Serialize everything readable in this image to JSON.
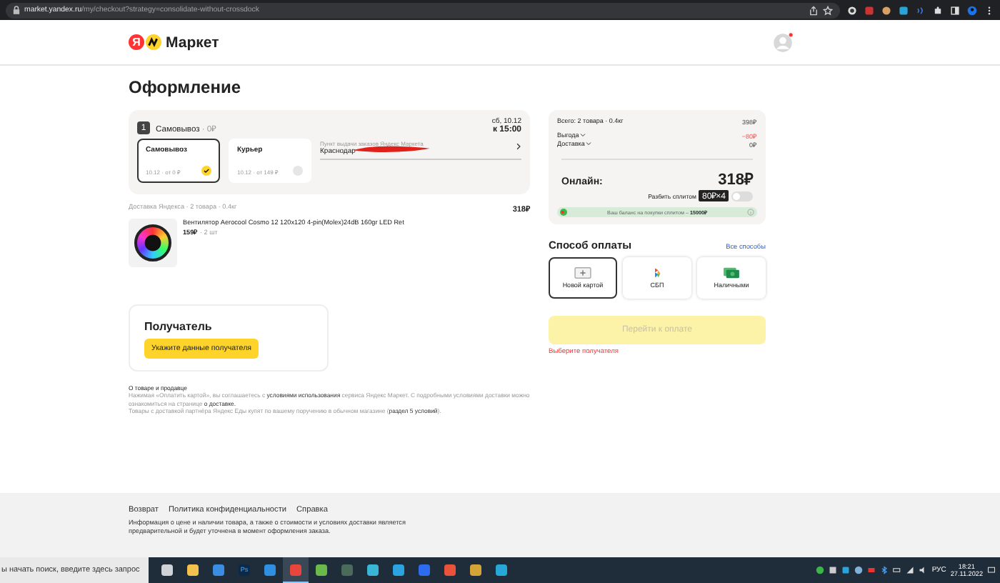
{
  "browser": {
    "url_domain": "market.yandex.ru",
    "url_path": "/my/checkout?strategy=consolidate-without-crossdock"
  },
  "header": {
    "logo_mark": "Я",
    "logo_text": "Маркет"
  },
  "page_title": "Оформление",
  "delivery": {
    "number": "1",
    "title": "Самовывоз",
    "price": " · 0₽",
    "date": "сб, 10.12",
    "time": "к 15:00",
    "options": [
      {
        "title": "Самовывоз",
        "detail": "10.12 · от 0 ₽",
        "selected": true
      },
      {
        "title": "Курьер",
        "detail": "10.12 · от 149 ₽",
        "selected": false
      }
    ],
    "pickup": {
      "label": "Пункт выдачи заказов Яндекс Маркета",
      "value": "Краснодар"
    },
    "shipment": {
      "label": "Доставка Яндекса · 2 товара · 0.4кг",
      "total": "318₽"
    },
    "products": [
      {
        "name": "Вентилятор Aerocool Cosmo 12 120x120 4-pin(Molex)24dB 160gr LED Ret",
        "price": "159₽",
        "qty": " · 2 шт"
      }
    ]
  },
  "recipient": {
    "title": "Получатель",
    "button": "Укажите данные получателя"
  },
  "legal": {
    "title": "О товаре и продавце",
    "paragraphs": [
      [
        {
          "text": "Нажимая «Оплатить картой», вы соглашаетесь с ",
          "link": false
        },
        {
          "text": "условиями использования",
          "link": true
        },
        {
          "text": " сервиса Яндекс Маркет. С подробными условиями доставки можно ознакомиться на странице ",
          "link": false
        },
        {
          "text": "о доставке.",
          "link": true
        }
      ],
      [
        {
          "text": "Товары с доставкой партнёра Яндекс Еды купят по вашему поручению в обычном магазине (",
          "link": false
        },
        {
          "text": "раздел 5 условий",
          "link": true
        },
        {
          "text": ").",
          "link": false
        }
      ]
    ]
  },
  "summary": {
    "rows": [
      {
        "label": "Всего: 2 товара · 0.4кг",
        "value": "398₽",
        "kind": "plain",
        "expandable": false
      },
      {
        "label": "Выгода",
        "value": "−80₽",
        "kind": "discount",
        "expandable": true
      },
      {
        "label": "Доставка",
        "value": "0₽",
        "kind": "plain",
        "expandable": true
      }
    ],
    "online_label": "Онлайн:",
    "online_amount": "318₽",
    "split": {
      "label": "Разбить сплитом",
      "badge": "80₽×4",
      "on": false
    },
    "balance": {
      "text": "Ваш баланс на покупки сплитом – ",
      "amount": "15000₽"
    }
  },
  "payment": {
    "title": "Способ оплаты",
    "link": "Все способы",
    "methods": [
      {
        "label": "Новой картой",
        "kind": "card",
        "selected": true
      },
      {
        "label": "СБП",
        "kind": "sbp",
        "selected": false
      },
      {
        "label": "Наличными",
        "kind": "cash",
        "selected": false
      }
    ],
    "pay_button": {
      "label": "Перейти к оплате",
      "disabled": true
    },
    "error": "Выберите получателя"
  },
  "footer": {
    "links": [
      "Возврат",
      "Политика конфиденциальности",
      "Справка"
    ],
    "note": "Информация о цене и наличии товара, а также о стоимости и условиях доставки является предварительной и будет уточнена в момент оформления заказа."
  },
  "taskbar": {
    "search": "ы начать поиск, введите здесь запрос",
    "apps": [
      {
        "kind": "taskview",
        "selected": false
      },
      {
        "kind": "folder",
        "selected": false
      },
      {
        "kind": "store",
        "selected": false
      },
      {
        "kind": "ps",
        "label": "Ps",
        "selected": false
      },
      {
        "kind": "mail",
        "selected": false
      },
      {
        "kind": "chrome",
        "selected": true
      },
      {
        "kind": "notepad",
        "selected": false
      },
      {
        "kind": "terminal",
        "selected": false
      },
      {
        "kind": "game",
        "selected": false
      },
      {
        "kind": "telegram",
        "selected": false
      },
      {
        "kind": "zoom",
        "selected": false
      },
      {
        "kind": "office",
        "selected": false
      },
      {
        "kind": "archive",
        "selected": false
      },
      {
        "kind": "chat",
        "selected": false
      }
    ],
    "lang": "РУС",
    "time": "18:21",
    "date": "27.11.2022"
  }
}
